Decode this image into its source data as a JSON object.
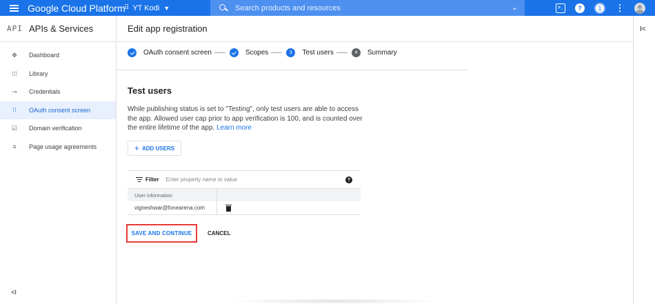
{
  "topbar": {
    "brand": "Google Cloud Platform",
    "project": "YT Kodi",
    "search_placeholder": "Search products and resources",
    "notification_count": "1"
  },
  "sidebar": {
    "badge": "API",
    "title": "APIs & Services",
    "items": [
      {
        "label": "Dashboard",
        "icon": "dashboard-icon"
      },
      {
        "label": "Library",
        "icon": "library-icon"
      },
      {
        "label": "Credentials",
        "icon": "key-icon"
      },
      {
        "label": "OAuth consent screen",
        "icon": "consent-icon",
        "active": true
      },
      {
        "label": "Domain verification",
        "icon": "domain-icon"
      },
      {
        "label": "Page usage agreements",
        "icon": "settings-list-icon"
      }
    ]
  },
  "main": {
    "title": "Edit app registration",
    "steps": [
      {
        "label": "OAuth consent screen",
        "state": "done"
      },
      {
        "label": "Scopes",
        "state": "done"
      },
      {
        "number": "3",
        "label": "Test users",
        "state": "current"
      },
      {
        "number": "4",
        "label": "Summary",
        "state": "upcoming"
      }
    ],
    "section_title": "Test users",
    "description": "While publishing status is set to \"Testing\", only test users are able to access the app. Allowed user cap prior to app verification is 100, and is counted over the entire lifetime of the app.",
    "learn_more": "Learn more",
    "add_users": "ADD USERS",
    "filter": {
      "label": "Filter",
      "placeholder": "Enter property name or value"
    },
    "table": {
      "header": "User information",
      "rows": [
        "vigneshwar@fonearena.com"
      ]
    },
    "save_label": "SAVE AND CONTINUE",
    "cancel_label": "CANCEL"
  },
  "colors": {
    "brand_blue": "#1a73e8",
    "highlight_red": "#e53935"
  }
}
